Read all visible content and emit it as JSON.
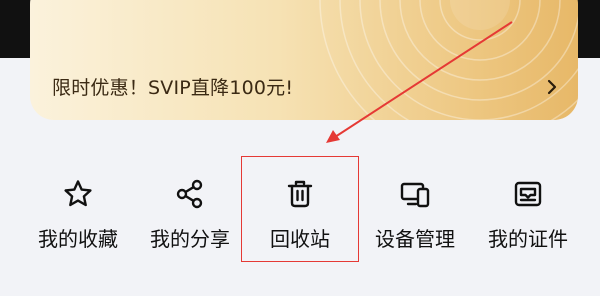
{
  "vip_card": {
    "promo_text": "限时优惠！SVIP直降100元!",
    "chevron_icon": "chevron-right-icon"
  },
  "shortcuts": [
    {
      "label": "我的收藏",
      "icon": "star-icon"
    },
    {
      "label": "我的分享",
      "icon": "share-icon"
    },
    {
      "label": "回收站",
      "icon": "trash-icon"
    },
    {
      "label": "设备管理",
      "icon": "devices-icon"
    },
    {
      "label": "我的证件",
      "icon": "id-card-icon"
    }
  ],
  "colors": {
    "page_background": "#f2f3f7",
    "card_gold_light": "#fbf2dc",
    "card_gold_dark": "#e7b868",
    "highlight_red": "#e53935"
  }
}
